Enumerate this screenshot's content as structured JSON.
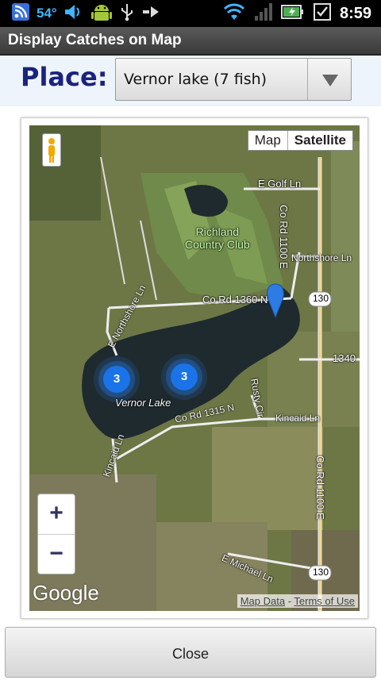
{
  "status_bar": {
    "temperature": "54°",
    "time": "8:59",
    "icons": [
      "rss-icon",
      "volume-icon",
      "android-icon",
      "usb-icon",
      "transfer-icon",
      "wifi-icon",
      "signal-icon",
      "battery-charging-icon",
      "checkbox-icon"
    ]
  },
  "title_bar": {
    "title": "Display Catches on Map"
  },
  "place": {
    "label": "Place:",
    "selected": "Vernor lake  (7 fish)"
  },
  "map": {
    "type_buttons": {
      "map": "Map",
      "satellite": "Satellite"
    },
    "zoom_in": "+",
    "zoom_out": "−",
    "logo": "Google",
    "credits": {
      "map_data": "Map Data",
      "separator": " - ",
      "terms": "Terms of Use"
    },
    "clusters": [
      {
        "count": "3"
      },
      {
        "count": "3"
      }
    ],
    "labels": {
      "golf": "E Golf Ln",
      "country_club": "Richland\nCountry Club",
      "co_rd_1100_top": "Co Rd 1100 E",
      "co_rd_1100_bottom": "Co Rd 1100 E",
      "northshore_e": "E Northshore Ln",
      "co_rd_1360": "Co Rd 1360 N",
      "northshore_right": "Northshore Ln",
      "route_130_top": "130",
      "route_1340": "1340",
      "vernor_lake": "Vernor Lake",
      "co_rd_1315": "Co Rd 1315 N",
      "rusty_cir": "Rusty Cir",
      "kincaid_ln": "Kincaid Ln",
      "kincaid_ln_left": "Kincaid Ln",
      "michael_ln": "E Michael Ln",
      "route_130_bottom": "130"
    }
  },
  "close_button": {
    "label": "Close"
  },
  "colors": {
    "accent": "#1a237e",
    "cluster": "#1a73e8",
    "statusbar": "#000000"
  }
}
